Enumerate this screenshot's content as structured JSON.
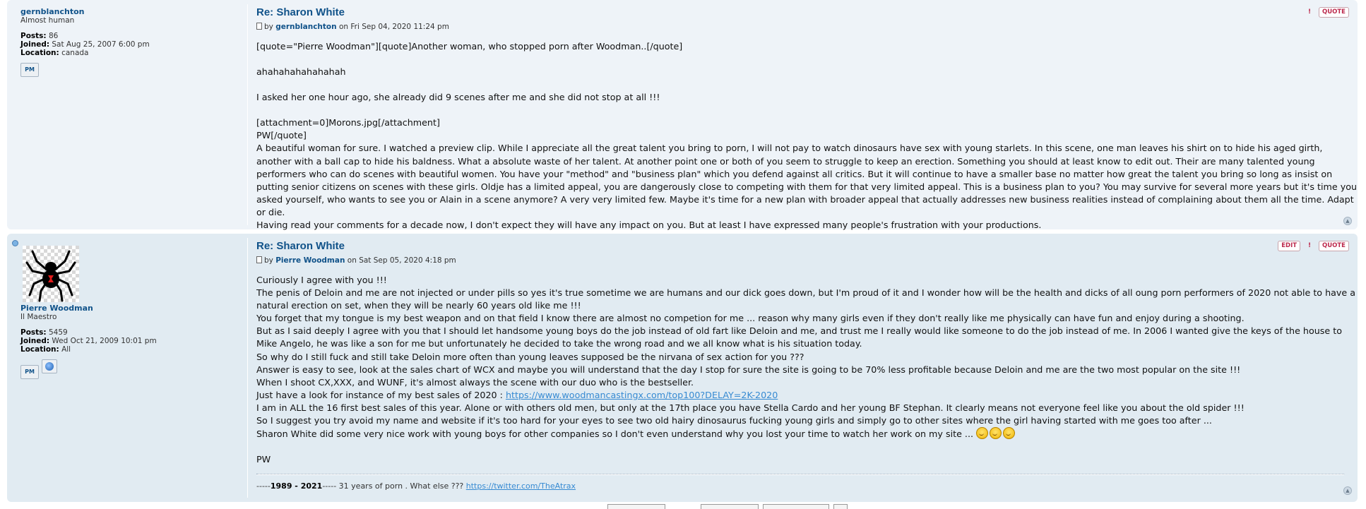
{
  "posts": [
    {
      "author": {
        "name": "gernblanchton",
        "rank": "Almost human",
        "posts_label": "Posts:",
        "posts": "86",
        "joined_label": "Joined:",
        "joined": "Sat Aug 25, 2007 6:00 pm",
        "location_label": "Location:",
        "location": "canada",
        "pm_label": "PM"
      },
      "title": "Re: Sharon White",
      "by": "by",
      "by_name": "gernblanchton",
      "date": "on Fri Sep 04, 2020 11:24 pm",
      "quote_label": "QUOTE",
      "report_label": "!",
      "lines": [
        "[quote=\"Pierre Woodman\"][quote]Another woman, who stopped porn after Woodman..[/quote]",
        "",
        "ahahahahahahahah",
        "",
        "I asked her one hour ago, she already did 9 scenes after me and she did not stop at all !!!",
        "",
        "[attachment=0]Morons.jpg[/attachment]",
        "PW[/quote]",
        "A beautiful woman for sure. I watched a preview clip. While I appreciate all the great talent you bring to porn, I will not pay to watch dinosaurs have sex with young starlets. In this scene, one man leaves his shirt on to hide his aged girth, another with a ball cap to hide his baldness. What a absolute waste of her talent. At another point one or both of you seem to struggle to keep an erection. Something you should at least know to edit out. Their are many talented young performers who can do scenes with beautiful women. You have your \"method\" and \"business plan\" which you defend against all critics. But it will continue to have a smaller base no matter how great the talent you bring so long as insist on putting senior citizens on scenes with these girls. Oldje has a limited appeal, you are dangerously close to competing with them for that very limited appeal. This is a business plan to you? You may survive for several more years but it's time you asked yourself, who wants to see you or Alain in a scene anymore? A very very limited few. Maybe it's time for a new plan with broader appeal that actually addresses new business realities instead of complaining about them all the time. Adapt or die.",
        "Having read your comments for a decade now, I don't expect they will have any impact on you. But at least I have expressed many people's frustration with your productions."
      ]
    },
    {
      "author": {
        "name": "Pierre Woodman",
        "rank": "Il Maestro",
        "posts_label": "Posts:",
        "posts": "5459",
        "joined_label": "Joined:",
        "joined": "Wed Oct 21, 2009 10:01 pm",
        "location_label": "Location:",
        "location": "All",
        "pm_label": "PM"
      },
      "title": "Re: Sharon White",
      "by": "by",
      "by_name": "Pierre Woodman",
      "date": "on Sat Sep 05, 2020 4:18 pm",
      "edit_label": "EDIT",
      "quote_label": "QUOTE",
      "report_label": "!",
      "lines": [
        "Curiously I agree with you !!!",
        "The penis of Deloin and me are not injected or under pills so yes it's true sometime we are humans and our dick goes down, but I'm proud of it and I wonder how will be the health and dicks of all oung porn performers of 2020 not able to have a natural erection on set, when they will be nearly 60 years old like me !!!",
        "You forget that my tongue is my best weapon and on that field I know there are almost no competion for me ... reason why many girls even if they don't really like me physically can have fun and enjoy during a shooting.",
        "But as I said deeply I agree with you that I should let handsome young boys do the job instead of old fart like Deloin and me, and trust me I really would like someone to do the job instead of me. In 2006 I wanted give the keys of the house to Mike Angelo, he was like a son for me but unfortunately he decided to take the wrong road and we all know what is his situation today.",
        "So why do I still fuck and still take Deloin more often than young leaves supposed be the nirvana of sex action for you ???",
        "Answer is easy to see, look at the sales chart of WCX and maybe you will understand that the day I stop for sure the site is going to be 70% less profitable because Deloin and me are the two most popular on the site !!!",
        "When I shoot CX,XXX, and WUNF, it's almost always the scene with our duo who is the bestseller."
      ],
      "link_prefix": "Just have a look for instance of my best sales of 2020 : ",
      "link": "https://www.woodmancastingx.com/top100?DELAY=2K-2020",
      "lines2": [
        "I am in ALL the 16 first best sales of this year. Alone or with others old men, but only at the 17th place you have Stella Cardo and her young BF Stephan. It clearly means not everyone feel like you about the old spider !!!",
        "So I suggest you try avoid my name and website if it's too hard for your eyes to see two old hairy dinosaurus fucking young girls and simply go to other sites where the girl having started with me goes too after ..."
      ],
      "last_line": "Sharon White did some very nice work with young boys for other companies so I don't even understand why you lost your time to watch her work on my site ...",
      "emoji_icon": "grin-emoji-icon",
      "signoff": "PW",
      "sig_prefix": "-----",
      "sig_bold": "1989 - 2021",
      "sig_mid": "----- 31 years of porn . What else ??? ",
      "sig_link": "https://twitter.com/TheAtrax"
    }
  ],
  "colors": {
    "post_bg_1": "#eef3f8",
    "post_bg_2": "#e1ebf2",
    "title": "#105289",
    "button_red": "#bc2a4d",
    "link": "#368ad2"
  }
}
